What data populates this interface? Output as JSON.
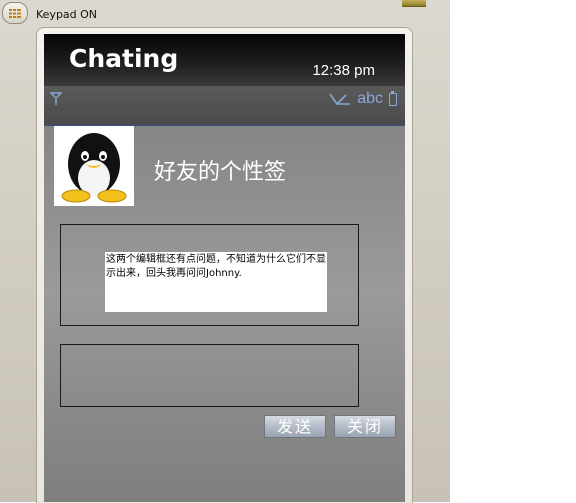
{
  "emulator": {
    "keypad_status": "Keypad ON"
  },
  "header": {
    "title": "Chating",
    "time": "12:38 pm"
  },
  "status": {
    "input_mode": "abc"
  },
  "profile": {
    "signature": "好友的个性签"
  },
  "message_box": {
    "text": "这两个编辑框还有点问题，不知道为什么它们不显示出来，回头我再问问Johnny."
  },
  "input_box": {
    "value": ""
  },
  "buttons": {
    "send": "发送",
    "close": "关闭"
  },
  "colors": {
    "screen_gray": "#8c8c8c",
    "titlebar_black": "#0a0a0a",
    "status_blue": "#8aa7d6"
  }
}
